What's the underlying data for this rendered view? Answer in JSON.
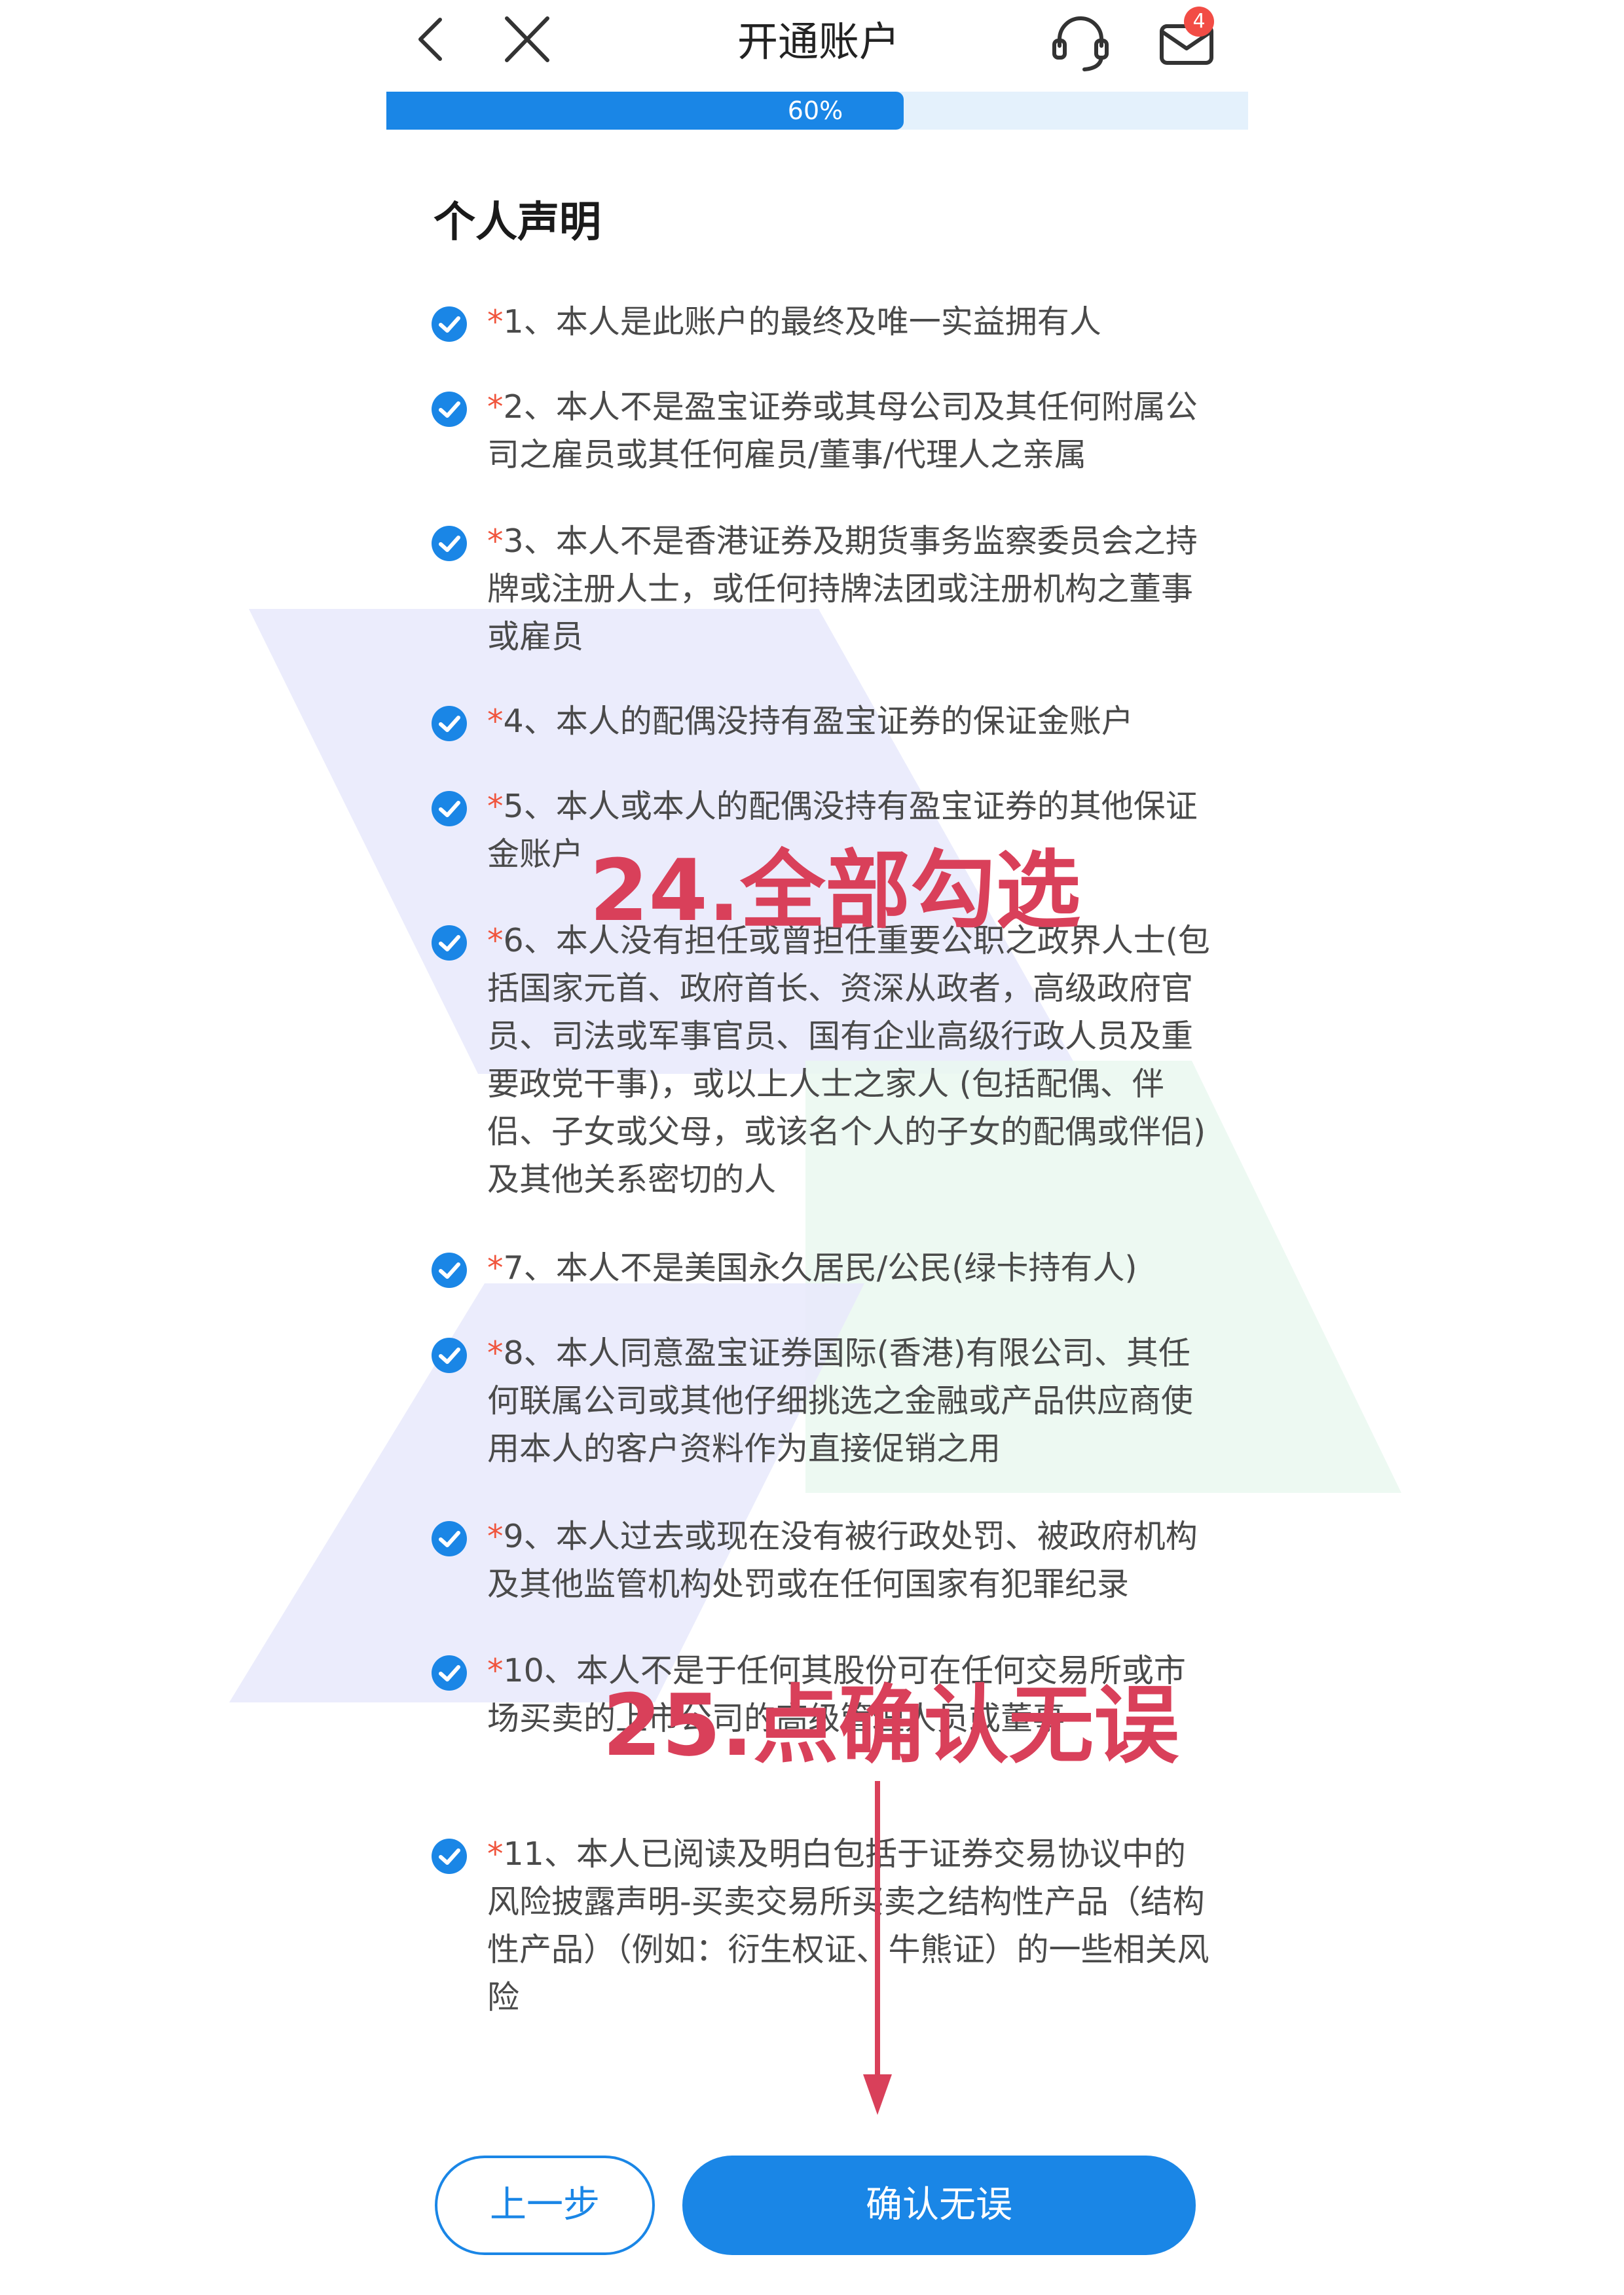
{
  "nav": {
    "title": "开通账户",
    "back_icon": "chevron-left-icon",
    "close_icon": "close-icon",
    "service_icon": "headset-icon",
    "mail_icon": "mail-icon",
    "mail_badge": "4"
  },
  "progress": {
    "value": 0.6,
    "label": "60%"
  },
  "section": {
    "title": "个人声明"
  },
  "statements": [
    {
      "number": "1",
      "text": "、本人是此账户的最终及唯一实益拥有人",
      "checked": true
    },
    {
      "number": "2",
      "text": "、本人不是盈宝证券或其母公司及其任何附属公司之雇员或其任何雇员/董事/代理人之亲属",
      "checked": true
    },
    {
      "number": "3",
      "text": "、本人不是香港证券及期货事务监察委员会之持牌或注册人士，或任何持牌法团或注册机构之董事或雇员",
      "checked": true
    },
    {
      "number": "4",
      "text": "、本人的配偶没持有盈宝证券的保证金账户",
      "checked": true
    },
    {
      "number": "5",
      "text": "、本人或本人的配偶没持有盈宝证券的其他保证金账户",
      "checked": true
    },
    {
      "number": "6",
      "text": "、本人没有担任或曾担任重要公职之政界人士(包括国家元首、政府首长、资深从政者，高级政府官员、司法或军事官员、国有企业高级行政人员及重要政党干事)，或以上人士之家人 (包括配偶、伴侣、子女或父母，或该名个人的子女的配偶或伴侣) 及其他关系密切的人",
      "checked": true
    },
    {
      "number": "7",
      "text": "、本人不是美国永久居民/公民(绿卡持有人)",
      "checked": true
    },
    {
      "number": "8",
      "text": "、本人同意盈宝证券国际(香港)有限公司、其任何联属公司或其他仔细挑选之金融或产品供应商使用本人的客户资料作为直接促销之用",
      "checked": true
    },
    {
      "number": "9",
      "text": "、本人过去或现在没有被行政处罚、被政府机构及其他监管机构处罚或在任何国家有犯罪纪录",
      "checked": true
    },
    {
      "number": "10",
      "text": "、本人不是于任何其股份可在任何交易所或市场买卖的上市公司的高级管理人员或董事",
      "checked": true
    },
    {
      "number": "11",
      "text": "、本人已阅读及明白包括于证券交易协议中的风险披露声明-买卖交易所买卖之结构性产品（结构性产品）（例如：衍生权证、牛熊证）的一些相关风险",
      "checked": true
    }
  ],
  "annotations": {
    "step24": "24.全部勾选",
    "step25": "25.点确认无误"
  },
  "buttons": {
    "prev": "上一步",
    "confirm": "确认无误"
  },
  "colors": {
    "accent": "#1a86e6",
    "required_star": "#f0553d",
    "annotation": "#d9405a",
    "badge": "#f24c45"
  }
}
